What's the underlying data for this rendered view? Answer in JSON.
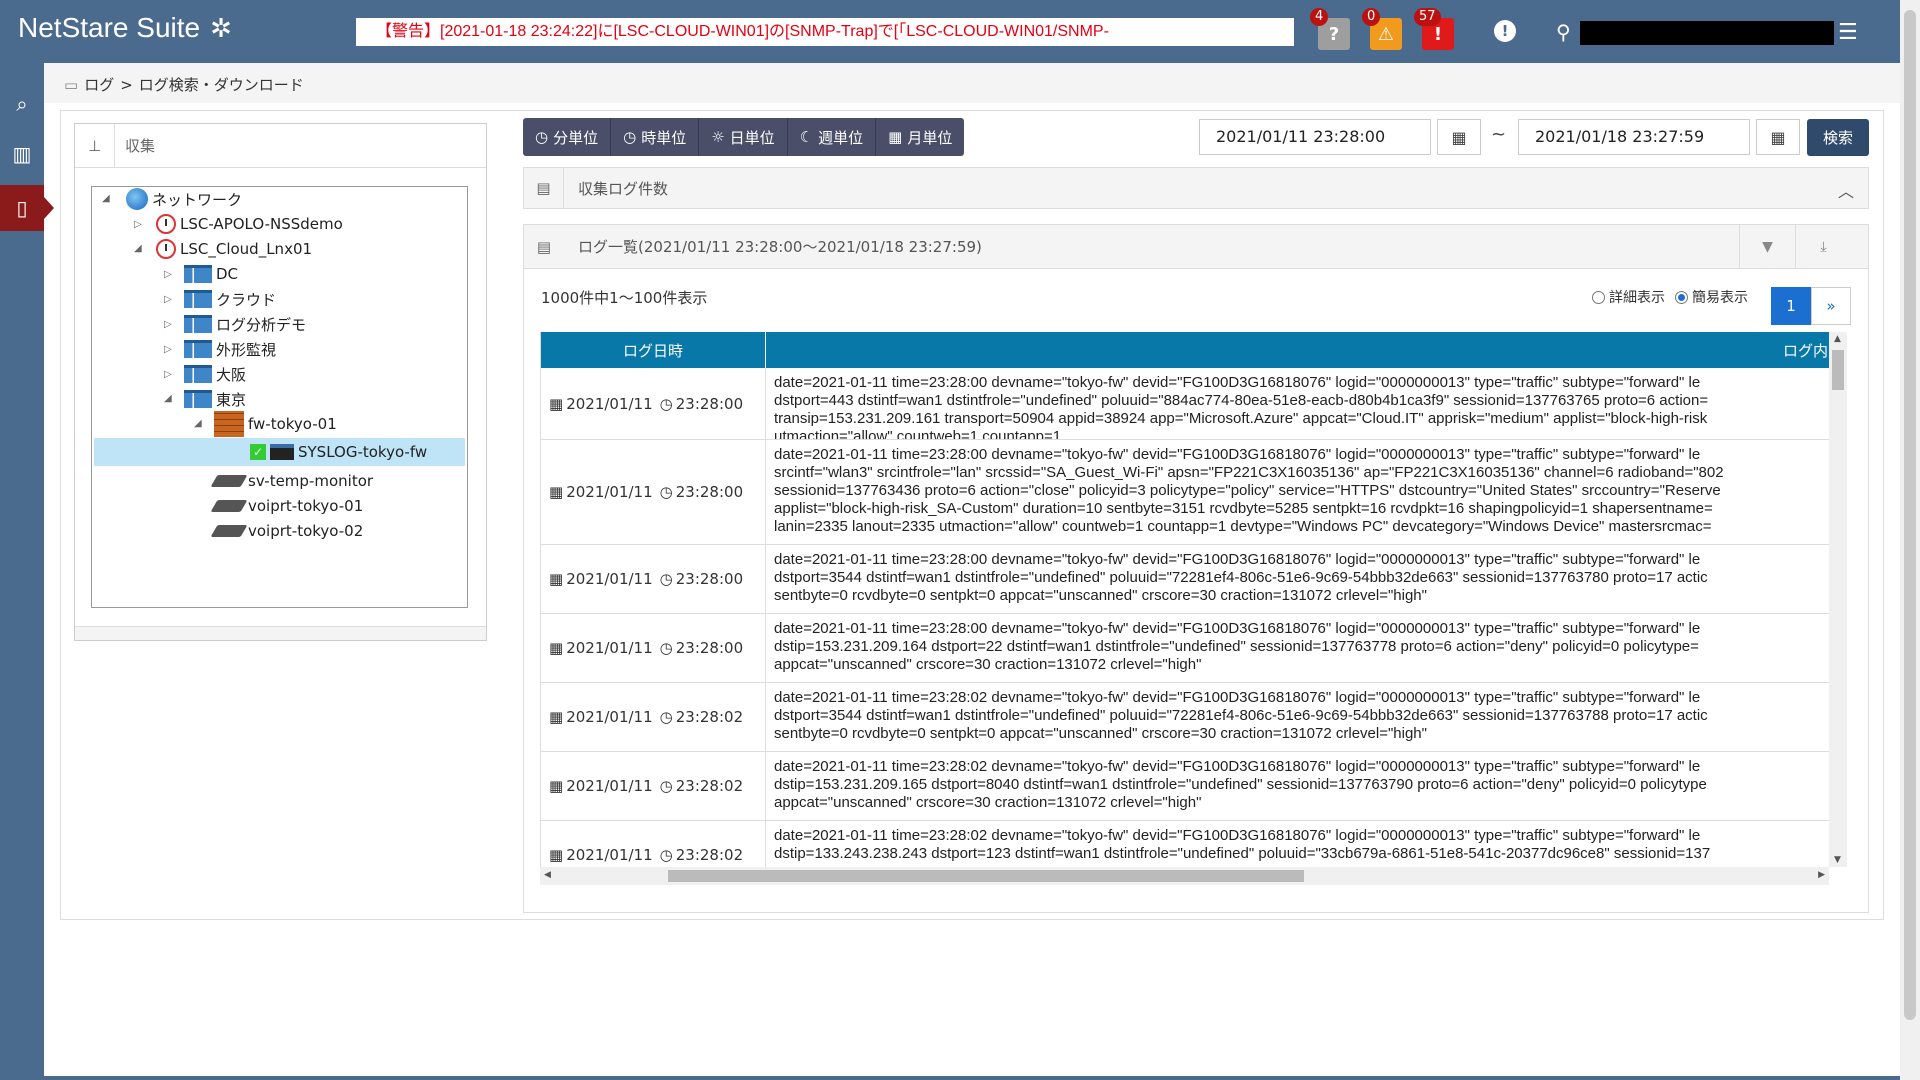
{
  "header": {
    "app_name": "NetStare Suite",
    "alert_text": "【警告】[2021-01-18 23:24:22]に[LSC-CLOUD-WIN01]の[SNMP-Trap]で[「LSC-CLOUD-WIN01/SNMP-",
    "badges": [
      {
        "icon": "question-icon",
        "count": "4",
        "color": "#9e9e9e"
      },
      {
        "icon": "warning-icon",
        "count": "0",
        "color": "#f29a1d"
      },
      {
        "icon": "error-icon",
        "count": "57",
        "color": "#e01a1a"
      }
    ]
  },
  "breadcrumb": {
    "root": "ログ",
    "sep": ">",
    "current": "ログ検索・ダウンロード"
  },
  "tree": {
    "title": "収集",
    "nodes": [
      {
        "label": "ネットワーク",
        "icon": "globe-icon"
      },
      {
        "label": "LSC-APOLO-NSSdemo",
        "icon": "server-icon"
      },
      {
        "label": "LSC_Cloud_Lnx01",
        "icon": "server-icon"
      },
      {
        "label": "DC",
        "icon": "group-icon"
      },
      {
        "label": "クラウド",
        "icon": "group-icon"
      },
      {
        "label": "ログ分析デモ",
        "icon": "group-icon"
      },
      {
        "label": "外形監視",
        "icon": "group-icon"
      },
      {
        "label": "大阪",
        "icon": "group-icon"
      },
      {
        "label": "東京",
        "icon": "group-icon"
      },
      {
        "label": "fw-tokyo-01",
        "icon": "firewall-icon"
      },
      {
        "label": "SYSLOG-tokyo-fw",
        "icon": "syslog-icon"
      },
      {
        "label": "sv-temp-monitor",
        "icon": "device-icon"
      },
      {
        "label": "voiprt-tokyo-01",
        "icon": "device-icon"
      },
      {
        "label": "voiprt-tokyo-02",
        "icon": "device-icon"
      }
    ]
  },
  "units": [
    "分単位",
    "時単位",
    "日単位",
    "週単位",
    "月単位"
  ],
  "date_from": "2021/01/11 23:28:00",
  "tilde": "~",
  "date_to": "2021/01/18 23:27:59",
  "search_label": "検索",
  "count_section": "収集ログ件数",
  "log_section": "ログ一覧(2021/01/11 23:28:00～2021/01/18 23:27:59)",
  "summary": "1000件中1～100件表示",
  "view_detail": "詳細表示",
  "view_simple": "簡易表示",
  "pager": {
    "current": "1",
    "next": "»"
  },
  "table": {
    "col_time": "ログ日時",
    "col_content": "ログ内",
    "rows": [
      {
        "date": "2021/01/11",
        "time": "23:28:00",
        "content": "date=2021-01-11 time=23:28:00 devname=\"tokyo-fw\" devid=\"FG100D3G16818076\" logid=\"0000000013\" type=\"traffic\" subtype=\"forward\" le\ndstport=443 dstintf=wan1 dstintfrole=\"undefined\" poluuid=\"884ac774-80ea-51e8-eacb-d80b4b1ca3f9\" sessionid=137763765 proto=6 action=\ntransip=153.231.209.161 transport=50904 appid=38924 app=\"Microsoft.Azure\" appcat=\"Cloud.IT\" apprisk=\"medium\" applist=\"block-high-risk\nutmaction=\"allow\" countweb=1 countapp=1"
      },
      {
        "date": "2021/01/11",
        "time": "23:28:00",
        "content": "date=2021-01-11 time=23:28:00 devname=\"tokyo-fw\" devid=\"FG100D3G16818076\" logid=\"0000000013\" type=\"traffic\" subtype=\"forward\" le\nsrcintf=\"wlan3\" srcintfrole=\"lan\" srcssid=\"SA_Guest_Wi-Fi\" apsn=\"FP221C3X16035136\" ap=\"FP221C3X16035136\" channel=6 radioband=\"802\nsessionid=137763436 proto=6 action=\"close\" policyid=3 policytype=\"policy\" service=\"HTTPS\" dstcountry=\"United States\" srccountry=\"Reserve\napplist=\"block-high-risk_SA-Custom\" duration=10 sentbyte=3151 rcvdbyte=5285 sentpkt=16 rcvdpkt=16 shapingpolicyid=1 shapersentname=\nlanin=2335 lanout=2335 utmaction=\"allow\" countweb=1 countapp=1 devtype=\"Windows PC\" devcategory=\"Windows Device\" mastersrcmac="
      },
      {
        "date": "2021/01/11",
        "time": "23:28:00",
        "content": "date=2021-01-11 time=23:28:00 devname=\"tokyo-fw\" devid=\"FG100D3G16818076\" logid=\"0000000013\" type=\"traffic\" subtype=\"forward\" le\ndstport=3544 dstintf=wan1 dstintfrole=\"undefined\" poluuid=\"72281ef4-806c-51e6-9c69-54bbb32de663\" sessionid=137763780 proto=17 actic\nsentbyte=0 rcvdbyte=0 sentpkt=0 appcat=\"unscanned\" crscore=30 craction=131072 crlevel=\"high\""
      },
      {
        "date": "2021/01/11",
        "time": "23:28:00",
        "content": "date=2021-01-11 time=23:28:00 devname=\"tokyo-fw\" devid=\"FG100D3G16818076\" logid=\"0000000013\" type=\"traffic\" subtype=\"forward\" le\ndstip=153.231.209.164 dstport=22 dstintf=wan1 dstintfrole=\"undefined\" sessionid=137763778 proto=6 action=\"deny\" policyid=0 policytype=\nappcat=\"unscanned\" crscore=30 craction=131072 crlevel=\"high\""
      },
      {
        "date": "2021/01/11",
        "time": "23:28:02",
        "content": "date=2021-01-11 time=23:28:02 devname=\"tokyo-fw\" devid=\"FG100D3G16818076\" logid=\"0000000013\" type=\"traffic\" subtype=\"forward\" le\ndstport=3544 dstintf=wan1 dstintfrole=\"undefined\" poluuid=\"72281ef4-806c-51e6-9c69-54bbb32de663\" sessionid=137763788 proto=17 actic\nsentbyte=0 rcvdbyte=0 sentpkt=0 appcat=\"unscanned\" crscore=30 craction=131072 crlevel=\"high\""
      },
      {
        "date": "2021/01/11",
        "time": "23:28:02",
        "content": "date=2021-01-11 time=23:28:02 devname=\"tokyo-fw\" devid=\"FG100D3G16818076\" logid=\"0000000013\" type=\"traffic\" subtype=\"forward\" le\ndstip=153.231.209.165 dstport=8040 dstintf=wan1 dstintfrole=\"undefined\" sessionid=137763790 proto=6 action=\"deny\" policyid=0 policytype\nappcat=\"unscanned\" crscore=30 craction=131072 crlevel=\"high\""
      },
      {
        "date": "2021/01/11",
        "time": "23:28:02",
        "content": "date=2021-01-11 time=23:28:02 devname=\"tokyo-fw\" devid=\"FG100D3G16818076\" logid=\"0000000013\" type=\"traffic\" subtype=\"forward\" le\ndstip=133.243.238.243 dstport=123 dstintf=wan1 dstintfrole=\"undefined\" poluuid=\"33cb679a-6861-51e8-541c-20377dc96ce8\" sessionid=137"
      }
    ]
  }
}
